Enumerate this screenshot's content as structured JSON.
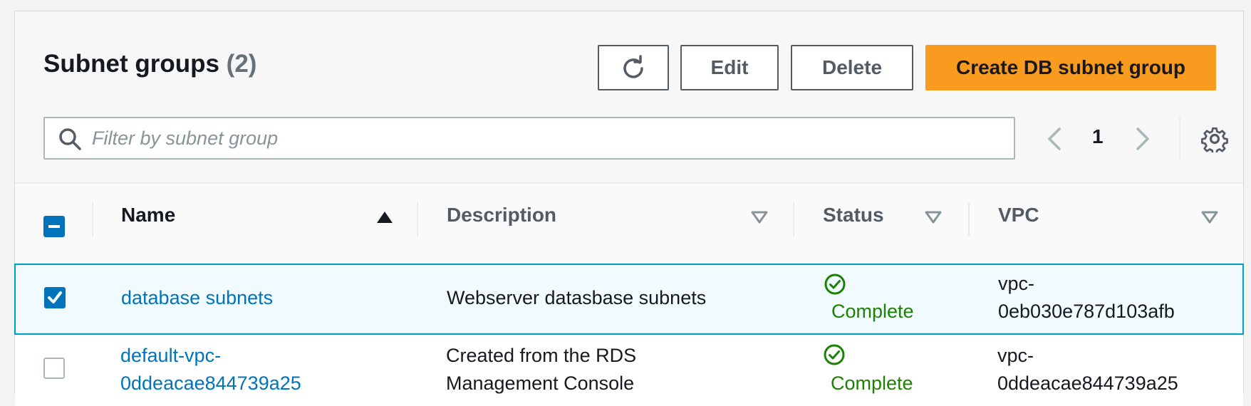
{
  "header": {
    "title": "Subnet groups",
    "count": "(2)",
    "edit_label": "Edit",
    "delete_label": "Delete",
    "create_label": "Create DB subnet group"
  },
  "search": {
    "placeholder": "Filter by subnet group",
    "value": ""
  },
  "pagination": {
    "current_page": "1"
  },
  "table": {
    "columns": [
      "Name",
      "Description",
      "Status",
      "VPC"
    ],
    "rows": [
      {
        "selected": true,
        "name": "database subnets",
        "description": "Webserver datasbase subnets",
        "status": "Complete",
        "vpc_line1": "vpc-",
        "vpc_line2": "0eb030e787d103afb"
      },
      {
        "selected": false,
        "name_line1": "default-vpc-",
        "name_line2": "0ddeacae844739a25",
        "description_line1": "Created from the RDS",
        "description_line2": "Management Console",
        "status": "Complete",
        "vpc_line1": "vpc-",
        "vpc_line2": "0ddeacae844739a25"
      }
    ]
  },
  "colors": {
    "primary": "#f89b1f",
    "link": "#0073bb",
    "success": "#1d8102",
    "selected_border": "#00a1c9"
  }
}
